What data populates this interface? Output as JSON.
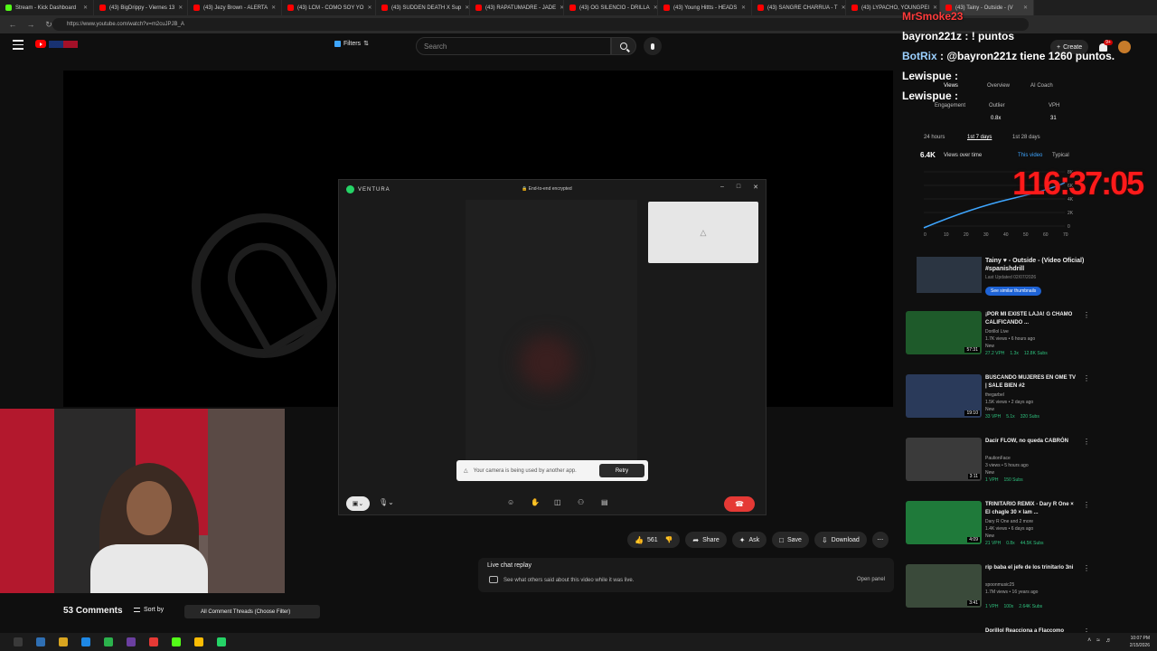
{
  "browser": {
    "tabs": [
      {
        "label": "Stream - Kick Dashboard",
        "kind": "kick"
      },
      {
        "label": "(43) BigDrippy - Viernes 13",
        "kind": "yt"
      },
      {
        "label": "(43) Jezy Brown - ALERTA",
        "kind": "yt"
      },
      {
        "label": "(43) LCM - COMO SOY YO",
        "kind": "yt"
      },
      {
        "label": "(43) SUDDEN DEATH X Sup",
        "kind": "yt"
      },
      {
        "label": "(43) RAPATUMADRE - JADE",
        "kind": "yt"
      },
      {
        "label": "(43) OG SILENCIO - DRILLA",
        "kind": "yt"
      },
      {
        "label": "(43) Young Hittts - HEADS",
        "kind": "yt"
      },
      {
        "label": "(43) SANGRE CHARRUA - T",
        "kind": "yt"
      },
      {
        "label": "(43) LYPACHO, YOUNGPEI",
        "kind": "yt"
      },
      {
        "label": "(43) Tainy - Outside - (V",
        "kind": "yt"
      }
    ],
    "url": "https://www.youtube.com/watch?v=m2cuJPJB_A"
  },
  "header": {
    "filters_label": "Filters",
    "search_placeholder": "Search",
    "create_label": "Create",
    "notif_count": "9+"
  },
  "call_dialog": {
    "contact": "VENTURA",
    "encryption": "End-to-end encrypted",
    "camera_warning": "Your camera is being used by another app.",
    "retry_label": "Retry"
  },
  "video_actions": {
    "likes": "561",
    "share": "Share",
    "ask": "Ask",
    "save": "Save",
    "download": "Download"
  },
  "live_chat": {
    "title": "Live chat replay",
    "subtitle": "See what others said about this video while it was live.",
    "open_panel": "Open panel"
  },
  "comments": {
    "count_label": "53 Comments",
    "sort_label": "Sort by",
    "threads_label": "All Comment Threads (Choose Filter)"
  },
  "chat_overlay": [
    {
      "user": "MrSmoke23",
      "text": ""
    },
    {
      "user": "bayron221z",
      "text": " : ! puntos"
    },
    {
      "user": "BotRix",
      "text": " : @bayron221z tiene 1260 puntos."
    },
    {
      "user": "Lewispue",
      "text": " :"
    },
    {
      "user": "Lewispue",
      "text": " :"
    }
  ],
  "stream_timer": "116:37:05",
  "vidiq": {
    "views_tab": "Views",
    "overview_tab": "Overview",
    "ai_coach_tab": "AI Coach",
    "engagement": "Engagement",
    "outlier_label": "Outlier",
    "outlier_value": "0.8x",
    "vph_label": "VPH",
    "vph_value": "31",
    "ranges": [
      "24 hours",
      "1st 7 days",
      "1st 28 days"
    ],
    "views_value": "6.4K",
    "views_over_time": "Views over time",
    "legend_this": "This video",
    "legend_typical": "Typical",
    "y_ticks": [
      "8K",
      "6K",
      "4K",
      "2K",
      "0"
    ],
    "x_ticks": [
      "0",
      "10",
      "20",
      "30",
      "40",
      "50",
      "60",
      "70"
    ]
  },
  "suggested": {
    "title": "Tainy ♥ - Outside - (Video Oficial) #spanishdrill",
    "sub": "Last Updated 02/07/2026",
    "button": "See similar thumbnails"
  },
  "recommendations": [
    {
      "title": "¡POR MI EXISTE LAJA! G CHAMO CALIFICANDO ...",
      "channel": "Dorillol Live",
      "meta": "1.7K views • 6 hours ago",
      "badge": "New",
      "stats": [
        "27.2 VPH",
        "1.3x",
        "12.8K Subs"
      ],
      "duration": "57:31"
    },
    {
      "title": "BUSCANDO MUJERES EN OME TV | SALE BIEN #2",
      "channel": "thegarbel",
      "meta": "1.5K views • 2 days ago",
      "badge": "New",
      "stats": [
        "33 VPH",
        "5.1x",
        "320 Subs"
      ],
      "duration": "19:10"
    },
    {
      "title": "Dacir FLOW, no queda CABRÓN",
      "channel": "PaulionFace",
      "meta": "3 views • 5 hours ago",
      "badge": "New",
      "stats": [
        "1 VPH",
        "150 Subs"
      ],
      "duration": "3:11"
    },
    {
      "title": "TRINITARIO REMIX - Dary R One × El chagle 30 × lam ...",
      "channel": "Dary R One and 2 more",
      "meta": "1.4K views • 6 days ago",
      "badge": "New",
      "stats": [
        "21 VPH",
        "0.8x",
        "44.5K Subs"
      ],
      "duration": "4:09"
    },
    {
      "title": "rip baba el jefe de los trinitario 3ni",
      "channel": "spoonmusic25",
      "meta": "1.7M views • 16 years ago",
      "badge": "",
      "stats": [
        "1 VPH",
        "100x",
        "2.64K Subs"
      ],
      "duration": "3:41"
    },
    {
      "title": "Dorillol Reacciona a Flaccomo",
      "channel": "",
      "meta": "",
      "badge": "",
      "stats": [],
      "duration": ""
    }
  ],
  "taskbar": {
    "time": "10:07 PM",
    "date": "2/15/2026"
  },
  "colors": {
    "accent_red": "#ff0000",
    "timer_red": "#ff1a1a",
    "whatsapp_green": "#25d366",
    "vph_green": "#2ec27e",
    "chart_line": "#3ea6ff"
  }
}
